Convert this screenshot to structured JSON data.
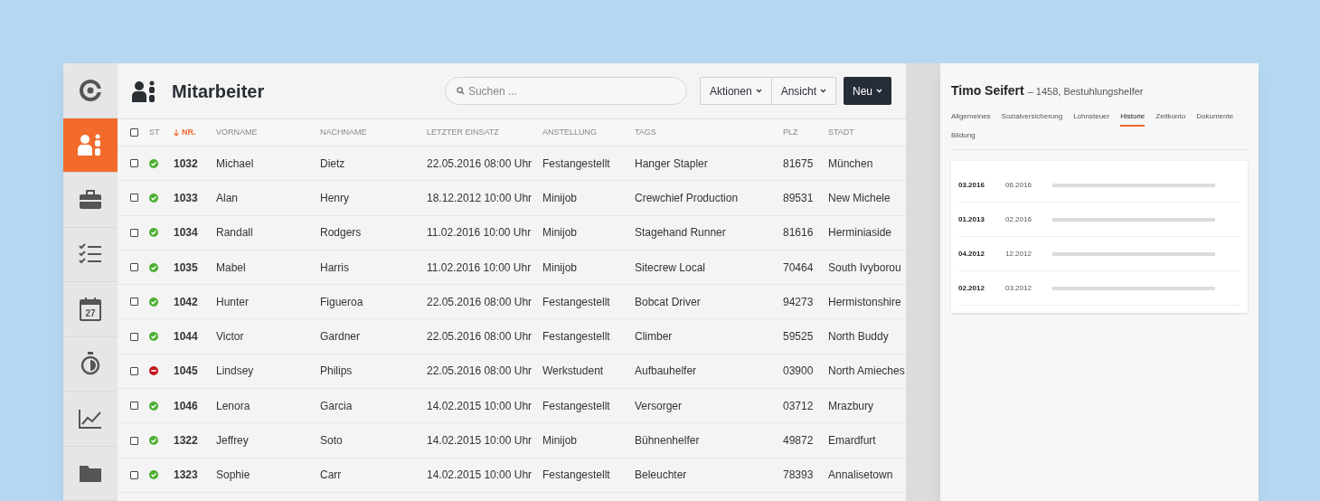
{
  "sidebar": {
    "items": [
      {
        "selected": false
      },
      {
        "selected": true
      },
      {
        "selected": false
      },
      {
        "selected": false
      },
      {
        "selected": false,
        "label": "27"
      },
      {
        "selected": false
      },
      {
        "selected": false
      },
      {
        "selected": false
      }
    ]
  },
  "header": {
    "title": "Mitarbeiter",
    "search": {
      "placeholder": "Suchen ..."
    },
    "buttons": [
      {
        "label": "Aktionen",
        "kind": "menu"
      },
      {
        "label": "Ansicht",
        "kind": "menu"
      },
      {
        "label": "Neu",
        "kind": "primary"
      }
    ]
  },
  "table": {
    "select_all_checked": false,
    "status_column": {
      "label": "ST",
      "sorted": false
    },
    "columns": [
      {
        "label": "NR.",
        "sorted": true
      },
      {
        "label": "VORNAME",
        "sorted": false
      },
      {
        "label": "NACHNAME",
        "sorted": false
      },
      {
        "label": "LETZTER EINSATZ",
        "sorted": false
      },
      {
        "label": "ANSTELLUNG",
        "sorted": false
      },
      {
        "label": "TAGS",
        "sorted": false
      },
      {
        "label": "PLZ",
        "sorted": false
      },
      {
        "label": "STADT",
        "sorted": false
      }
    ],
    "rows": [
      {
        "checked": false,
        "kind": "active",
        "cells": [
          "1032",
          "Michael",
          "Dietz",
          "22.05.2016 08:00 Uhr",
          "Festangestellt",
          "Hanger Stapler",
          "81675",
          "München"
        ]
      },
      {
        "checked": false,
        "kind": "active",
        "cells": [
          "1033",
          "Alan",
          "Henry",
          "18.12.2012 10:00 Uhr",
          "Minijob",
          "Crewchief Production",
          "89531",
          "New Michele"
        ]
      },
      {
        "checked": false,
        "kind": "active",
        "cells": [
          "1034",
          "Randall",
          "Rodgers",
          "11.02.2016 10:00 Uhr",
          "Minijob",
          "Stagehand Runner",
          "81616",
          "Herminiaside"
        ]
      },
      {
        "checked": false,
        "kind": "active",
        "cells": [
          "1035",
          "Mabel",
          "Harris",
          "11.02.2016 10:00 Uhr",
          "Minijob",
          "Sitecrew Local",
          "70464",
          "South Ivyborou"
        ]
      },
      {
        "checked": false,
        "kind": "active",
        "cells": [
          "1042",
          "Hunter",
          "Figueroa",
          "22.05.2016 08:00 Uhr",
          "Festangestellt",
          "Bobcat Driver",
          "94273",
          "Hermistonshire"
        ]
      },
      {
        "checked": false,
        "kind": "active",
        "cells": [
          "1044",
          "Victor",
          "Gardner",
          "22.05.2016 08:00 Uhr",
          "Festangestellt",
          "Climber",
          "59525",
          "North Buddy"
        ]
      },
      {
        "checked": false,
        "kind": "blocked",
        "cells": [
          "1045",
          "Lindsey",
          "Philips",
          "22.05.2016 08:00 Uhr",
          "Werkstudent",
          "Aufbauhelfer",
          "03900",
          "North Amieches"
        ]
      },
      {
        "checked": false,
        "kind": "active",
        "cells": [
          "1046",
          "Lenora",
          "Garcia",
          "14.02.2015 10:00 Uhr",
          "Festangestellt",
          "Versorger",
          "03712",
          "Mrazbury"
        ]
      },
      {
        "checked": false,
        "kind": "active",
        "cells": [
          "1322",
          "Jeffrey",
          "Soto",
          "14.02.2015 10:00 Uhr",
          "Minijob",
          "Bühnenhelfer",
          "49872",
          "Emardfurt"
        ]
      },
      {
        "checked": false,
        "kind": "active",
        "cells": [
          "1323",
          "Sophie",
          "Carr",
          "14.02.2015 10:00 Uhr",
          "Festangestellt",
          "Beleuchter",
          "78393",
          "Annalisetown"
        ]
      }
    ]
  },
  "detail": {
    "name": "Timo Seifert",
    "subtitle": "– 1458, Bestuhlungshelfer",
    "tabs": [
      {
        "label": "Allgemeines",
        "selected": false
      },
      {
        "label": "Sozialversicherung",
        "selected": false
      },
      {
        "label": "Lohnsteuer",
        "selected": false
      },
      {
        "label": "Historie",
        "selected": true
      },
      {
        "label": "Zeitkonto",
        "selected": false
      },
      {
        "label": "Dokumente",
        "selected": false
      },
      {
        "label": "Bildung",
        "selected": false
      }
    ],
    "rows": [
      {
        "from": "03.2016",
        "to": "06.2016"
      },
      {
        "from": "01.2013",
        "to": "02.2016"
      },
      {
        "from": "04.2012",
        "to": "12.2012"
      },
      {
        "from": "02.2012",
        "to": "03.2012"
      }
    ]
  }
}
